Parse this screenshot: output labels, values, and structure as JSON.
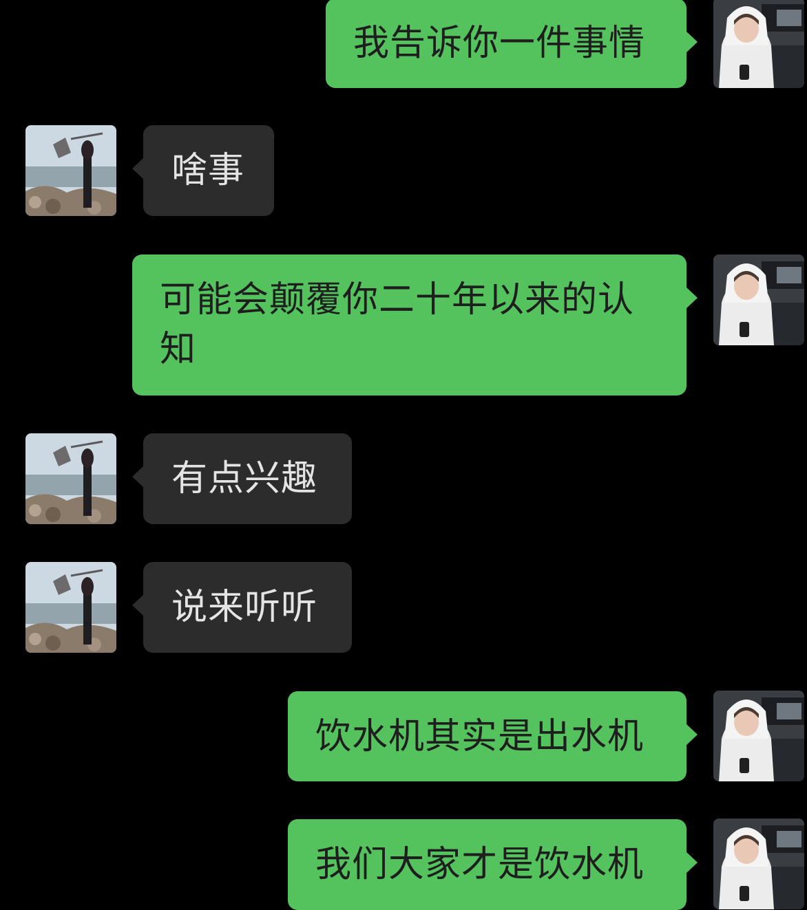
{
  "chat": {
    "messages": [
      {
        "sender": "me",
        "text": "我告诉你一件事情"
      },
      {
        "sender": "other",
        "text": "啥事"
      },
      {
        "sender": "me",
        "text": "可能会颠覆你二十年以来的认知"
      },
      {
        "sender": "other",
        "text": "有点兴趣"
      },
      {
        "sender": "other",
        "text": "说来听听"
      },
      {
        "sender": "me",
        "text": "饮水机其实是出水机"
      },
      {
        "sender": "me",
        "text": "我们大家才是饮水机"
      }
    ]
  },
  "colors": {
    "background": "#000000",
    "sent_bubble": "#54c35e",
    "received_bubble": "#2c2c2c",
    "sent_text": "#1e1e1e",
    "received_text": "#e4e4e4"
  }
}
